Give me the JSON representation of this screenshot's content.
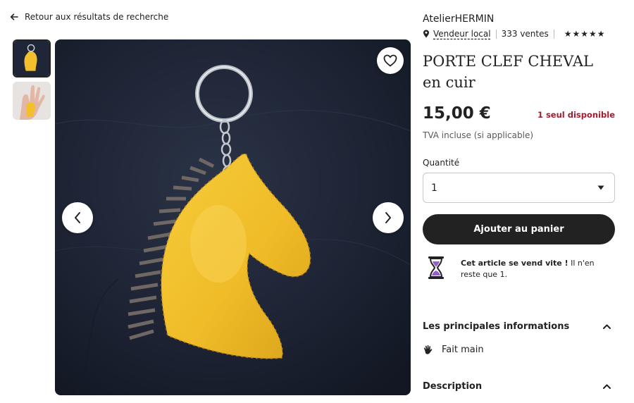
{
  "nav": {
    "back_label": "Retour aux résultats de recherche"
  },
  "gallery": {
    "thumbnails": [
      {
        "label": "main",
        "active": true
      },
      {
        "label": "hand",
        "active": false
      }
    ]
  },
  "shop": {
    "name": "AtelierHERMIN",
    "local_label": "Vendeur local",
    "sales": "333 ventes",
    "stars": "★★★★★"
  },
  "product": {
    "title": "PORTE CLEF CHEVAL en cuir",
    "price": "15,00 €",
    "stock": "1 seul disponible",
    "tax_note": "TVA incluse (si applicable)"
  },
  "quantity": {
    "label": "Quantité",
    "value": "1"
  },
  "cart": {
    "button_label": "Ajouter au panier"
  },
  "alert": {
    "bold": "Cet article se vend vite !",
    "rest": " Il n'en reste que 1."
  },
  "sections": {
    "info_title": "Les principales informations",
    "feature_handmade": "Fait main",
    "description_title": "Description"
  },
  "colors": {
    "accent": "#222222",
    "stock_red": "#a61a2e",
    "leather_yellow": "#f3c12e"
  }
}
